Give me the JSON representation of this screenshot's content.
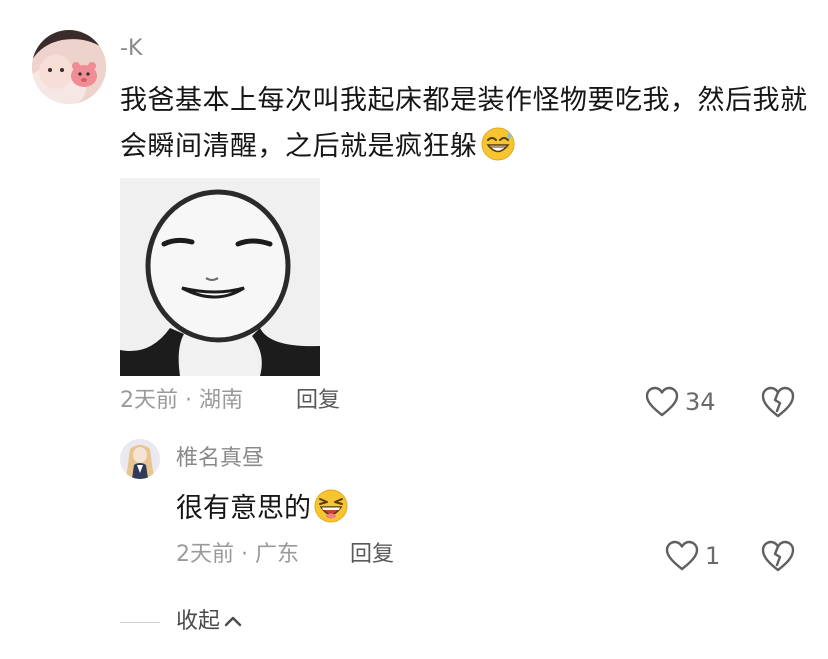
{
  "comment": {
    "username": "-K",
    "text": "我爸基本上每次叫我起床都是装作怪物要吃我，然后我就会瞬间清醒，之后就是疯狂躲",
    "emoji": "grinning-sweat-emoji",
    "attachment": "smiling-face-sticker",
    "meta": "2天前 · 湖南",
    "reply_label": "回复",
    "like_count": "34"
  },
  "reply": {
    "username": "椎名真昼",
    "text": "很有意思的",
    "emoji": "laughing-emoji",
    "meta": "2天前 · 广东",
    "reply_label": "回复",
    "like_count": "1"
  },
  "collapse": {
    "label": "收起"
  },
  "colors": {
    "text_primary": "#161616",
    "text_secondary": "#9a9a9a",
    "icon": "#5f5f5f",
    "emoji_yellow": "#f7c531",
    "emoji_mouth": "#d13b3b"
  }
}
